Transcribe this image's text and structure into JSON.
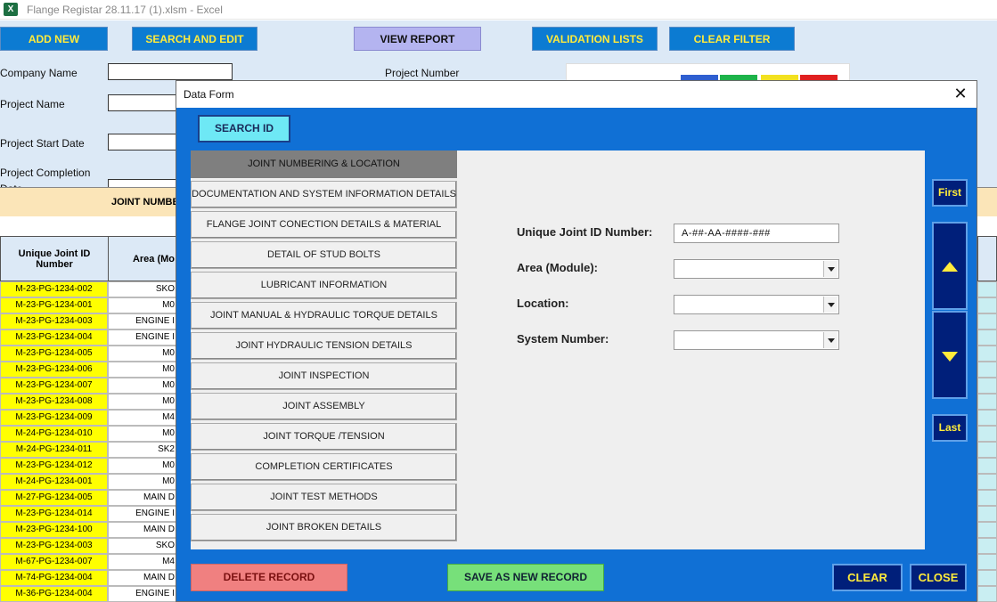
{
  "window": {
    "title": "Flange Registar 28.11.17 (1).xlsm - Excel",
    "icon": "excel-icon"
  },
  "sheet": {
    "buttons": {
      "add_new": "ADD NEW",
      "search_edit": "SEARCH AND EDIT",
      "view_report": "VIEW REPORT",
      "validation_lists": "VALIDATION LISTS",
      "clear_filter": "CLEAR FILTER"
    },
    "labels": {
      "company_name": "Company Name",
      "project_name": "Project Name",
      "project_start": "Project Start Date",
      "project_completion_1": "Project Completion",
      "project_completion_2": "Date",
      "project_number": "Project Number"
    },
    "table": {
      "band_label": "JOINT NUMBE",
      "col_id": "Unique Joint ID Number",
      "col_area": "Area (Mo",
      "rows": [
        {
          "id": "M-23-PG-1234-002",
          "area": "SKO"
        },
        {
          "id": "M-23-PG-1234-001",
          "area": "M0"
        },
        {
          "id": "M-23-PG-1234-003",
          "area": "ENGINE I"
        },
        {
          "id": "M-23-PG-1234-004",
          "area": "ENGINE I"
        },
        {
          "id": "M-23-PG-1234-005",
          "area": "M0"
        },
        {
          "id": "M-23-PG-1234-006",
          "area": "M0"
        },
        {
          "id": "M-23-PG-1234-007",
          "area": "M0"
        },
        {
          "id": "M-23-PG-1234-008",
          "area": "M0"
        },
        {
          "id": "M-23-PG-1234-009",
          "area": "M4"
        },
        {
          "id": "M-24-PG-1234-010",
          "area": "M0"
        },
        {
          "id": "M-24-PG-1234-011",
          "area": "SK2"
        },
        {
          "id": "M-23-PG-1234-012",
          "area": "M0"
        },
        {
          "id": "M-24-PG-1234-001",
          "area": "M0"
        },
        {
          "id": "M-27-PG-1234-005",
          "area": "MAIN D"
        },
        {
          "id": "M-23-PG-1234-014",
          "area": "ENGINE I"
        },
        {
          "id": "M-23-PG-1234-100",
          "area": "MAIN D"
        },
        {
          "id": "M-23-PG-1234-003",
          "area": "SKO"
        },
        {
          "id": "M-67-PG-1234-007",
          "area": "M4"
        },
        {
          "id": "M-74-PG-1234-004",
          "area": "MAIN D"
        },
        {
          "id": "M-36-PG-1234-004",
          "area": "ENGINE I"
        }
      ]
    }
  },
  "dialog": {
    "title": "Data Form",
    "search_id": "SEARCH ID",
    "tabs": [
      "JOINT NUMBERING & LOCATION",
      "DOCUMENTATION AND SYSTEM INFORMATION DETAILS",
      "FLANGE JOINT CONECTION DETAILS & MATERIAL",
      "DETAIL OF STUD BOLTS",
      "LUBRICANT INFORMATION",
      "JOINT MANUAL & HYDRAULIC TORQUE  DETAILS",
      "JOINT HYDRAULIC TENSION  DETAILS",
      "JOINT INSPECTION",
      "JOINT ASSEMBLY",
      "JOINT TORQUE /TENSION",
      "COMPLETION CERTIFICATES",
      "JOINT TEST METHODS",
      "JOINT BROKEN DETAILS"
    ],
    "fields": {
      "joint_id_label": "Unique Joint ID Number:",
      "joint_id_value": "A-##-AA-####-###",
      "area_label": "Area (Module):",
      "area_value": "",
      "location_label": "Location:",
      "location_value": "",
      "system_label": "System Number:",
      "system_value": ""
    },
    "nav": {
      "first": "First",
      "last": "Last"
    },
    "buttons": {
      "delete": "DELETE RECORD",
      "save_new": "SAVE AS NEW RECORD",
      "clear": "CLEAR",
      "close": "CLOSE"
    }
  }
}
